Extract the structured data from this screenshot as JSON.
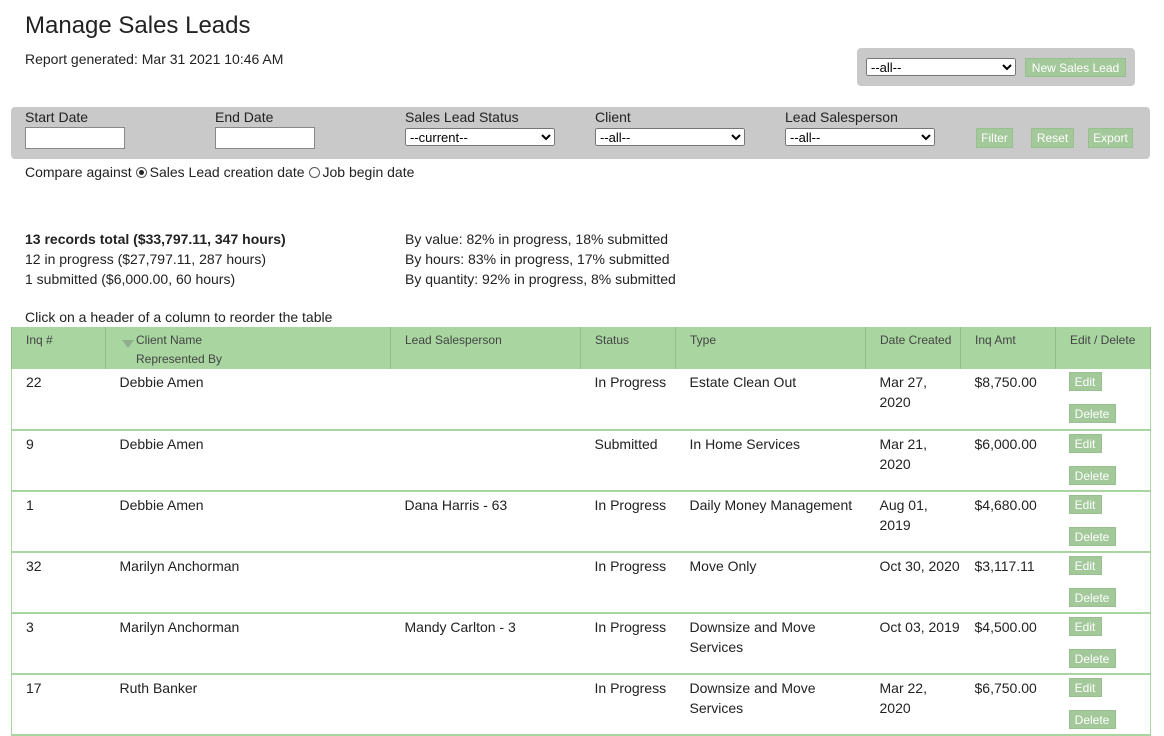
{
  "header": {
    "title": "Manage Sales Leads",
    "report_generated": "Report generated: Mar 31 2021 10:46 AM"
  },
  "top_right": {
    "select_value": "--all--",
    "new_lead_label": "New Sales Lead"
  },
  "filters": {
    "start_date_label": "Start Date",
    "end_date_label": "End Date",
    "status_label": "Sales Lead Status",
    "status_value": "--current--",
    "client_label": "Client",
    "client_value": "--all--",
    "salesperson_label": "Lead Salesperson",
    "salesperson_value": "--all--",
    "filter_label": "Filter",
    "reset_label": "Reset",
    "export_label": "Export"
  },
  "compare": {
    "label": "Compare against",
    "option1": "Sales Lead creation date",
    "option2": "Job begin date",
    "selected": "option1"
  },
  "summary": {
    "total": "13 records total ($33,797.11, 347 hours)",
    "in_progress": "12 in progress ($27,797.11, 287 hours)",
    "submitted": "1 submitted ($6,000.00, 60 hours)",
    "by_value": "By value: 82% in progress, 18% submitted",
    "by_hours": "By hours: 83% in progress, 17% submitted",
    "by_quantity": "By quantity: 92% in progress, 8% submitted"
  },
  "hint": "Click on a header of a column to reorder the table",
  "table": {
    "headers": {
      "inq": "Inq #",
      "client": "Client Name",
      "represented": "Represented By",
      "salesperson": "Lead Salesperson",
      "status": "Status",
      "type": "Type",
      "date": "Date Created",
      "amt": "Inq Amt",
      "actions": "Edit / Delete"
    },
    "edit_label": "Edit",
    "delete_label": "Delete",
    "rows": [
      {
        "inq": "22",
        "client": "Debbie Amen",
        "salesperson": "",
        "status": "In Progress",
        "type": "Estate Clean Out",
        "date": "Mar 27, 2020",
        "amt": "$8,750.00"
      },
      {
        "inq": "9",
        "client": "Debbie Amen",
        "salesperson": "",
        "status": "Submitted",
        "type": "In Home Services",
        "date": "Mar 21, 2020",
        "amt": "$6,000.00"
      },
      {
        "inq": "1",
        "client": "Debbie Amen",
        "salesperson": "Dana Harris - 63",
        "status": "In Progress",
        "type": "Daily Money Management",
        "date": "Aug 01, 2019",
        "amt": "$4,680.00"
      },
      {
        "inq": "32",
        "client": "Marilyn Anchorman",
        "salesperson": "",
        "status": "In Progress",
        "type": "Move Only",
        "date": "Oct 30, 2020",
        "amt": "$3,117.11"
      },
      {
        "inq": "3",
        "client": "Marilyn Anchorman",
        "salesperson": "Mandy Carlton - 3",
        "status": "In Progress",
        "type": "Downsize and Move Services",
        "date": "Oct 03, 2019",
        "amt": "$4,500.00"
      },
      {
        "inq": "17",
        "client": "Ruth Banker",
        "salesperson": "",
        "status": "In Progress",
        "type": "Downsize and Move Services",
        "date": "Mar 22, 2020",
        "amt": "$6,750.00"
      }
    ]
  }
}
